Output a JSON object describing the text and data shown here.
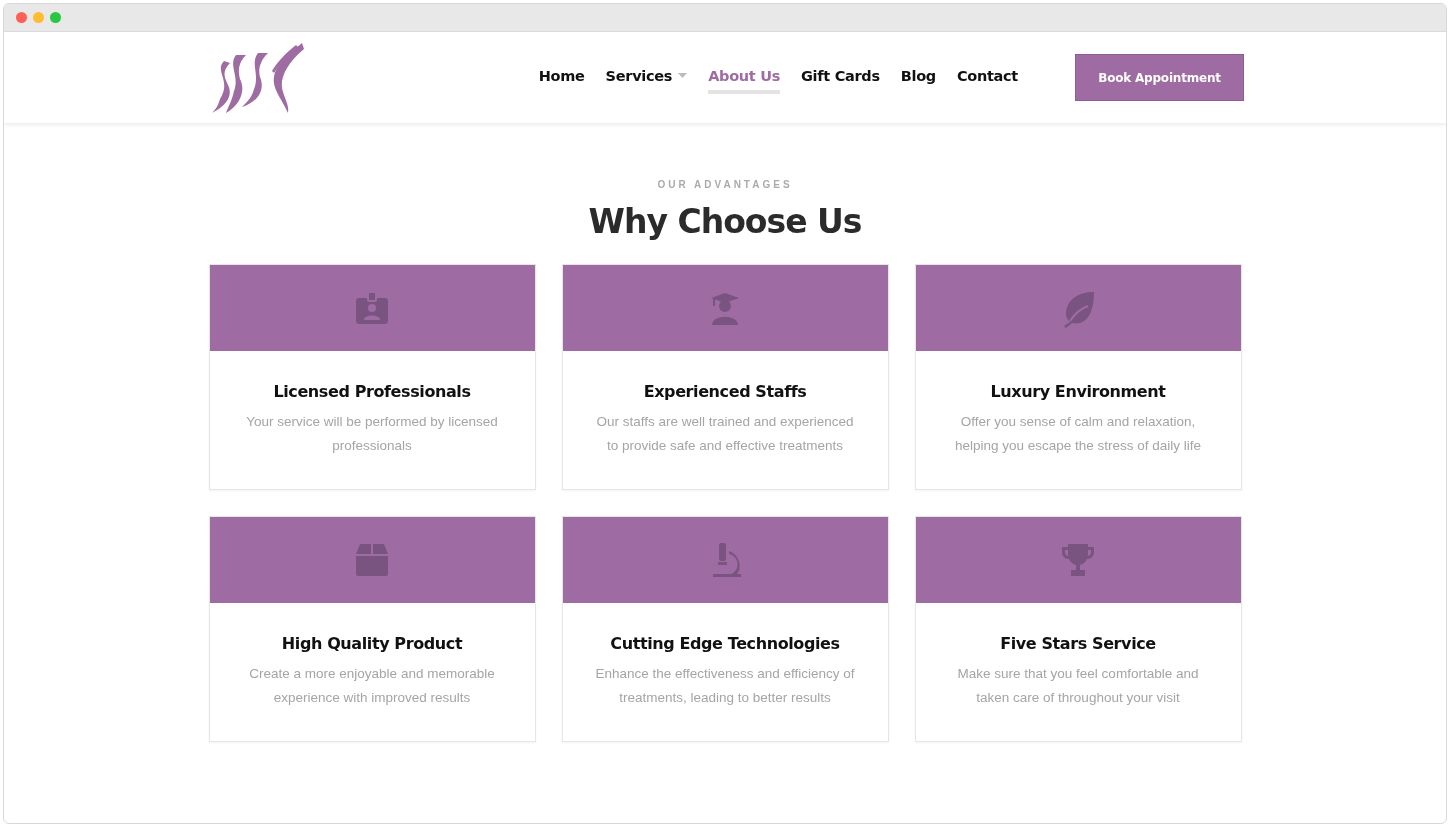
{
  "nav": {
    "items": [
      {
        "label": "Home",
        "selected": false,
        "dropdown": false
      },
      {
        "label": "Services",
        "selected": false,
        "dropdown": true
      },
      {
        "label": "About Us",
        "selected": true,
        "dropdown": false
      },
      {
        "label": "Gift Cards",
        "selected": false,
        "dropdown": false
      },
      {
        "label": "Blog",
        "selected": false,
        "dropdown": false
      },
      {
        "label": "Contact",
        "selected": false,
        "dropdown": false
      }
    ],
    "cta": "Book Appointment"
  },
  "section": {
    "eyebrow": "OUR ADVANTAGES",
    "title": "Why Choose Us",
    "cards": [
      {
        "kind": "id-badge",
        "title": "Licensed Professionals",
        "lines": [
          "Your service will be performed by licensed",
          "professionals"
        ]
      },
      {
        "kind": "graduate",
        "title": "Experienced Staffs",
        "lines": [
          "Our staffs are well trained and experienced",
          "to provide safe and effective treatments"
        ]
      },
      {
        "kind": "leaf",
        "title": "Luxury Environment",
        "lines": [
          "Offer you sense of calm and relaxation,",
          "helping you escape the stress of daily life"
        ]
      },
      {
        "kind": "box",
        "title": "High Quality Product",
        "lines": [
          "Create a more enjoyable and memorable",
          "experience with improved results"
        ]
      },
      {
        "kind": "microscope",
        "title": "Cutting Edge Technologies",
        "lines": [
          "Enhance the effectiveness and efficiency of",
          "treatments, leading to better results"
        ]
      },
      {
        "kind": "trophy",
        "title": "Five Stars Service",
        "lines": [
          "Make sure that you feel comfortable and",
          "taken care of throughout your visit"
        ]
      }
    ]
  }
}
